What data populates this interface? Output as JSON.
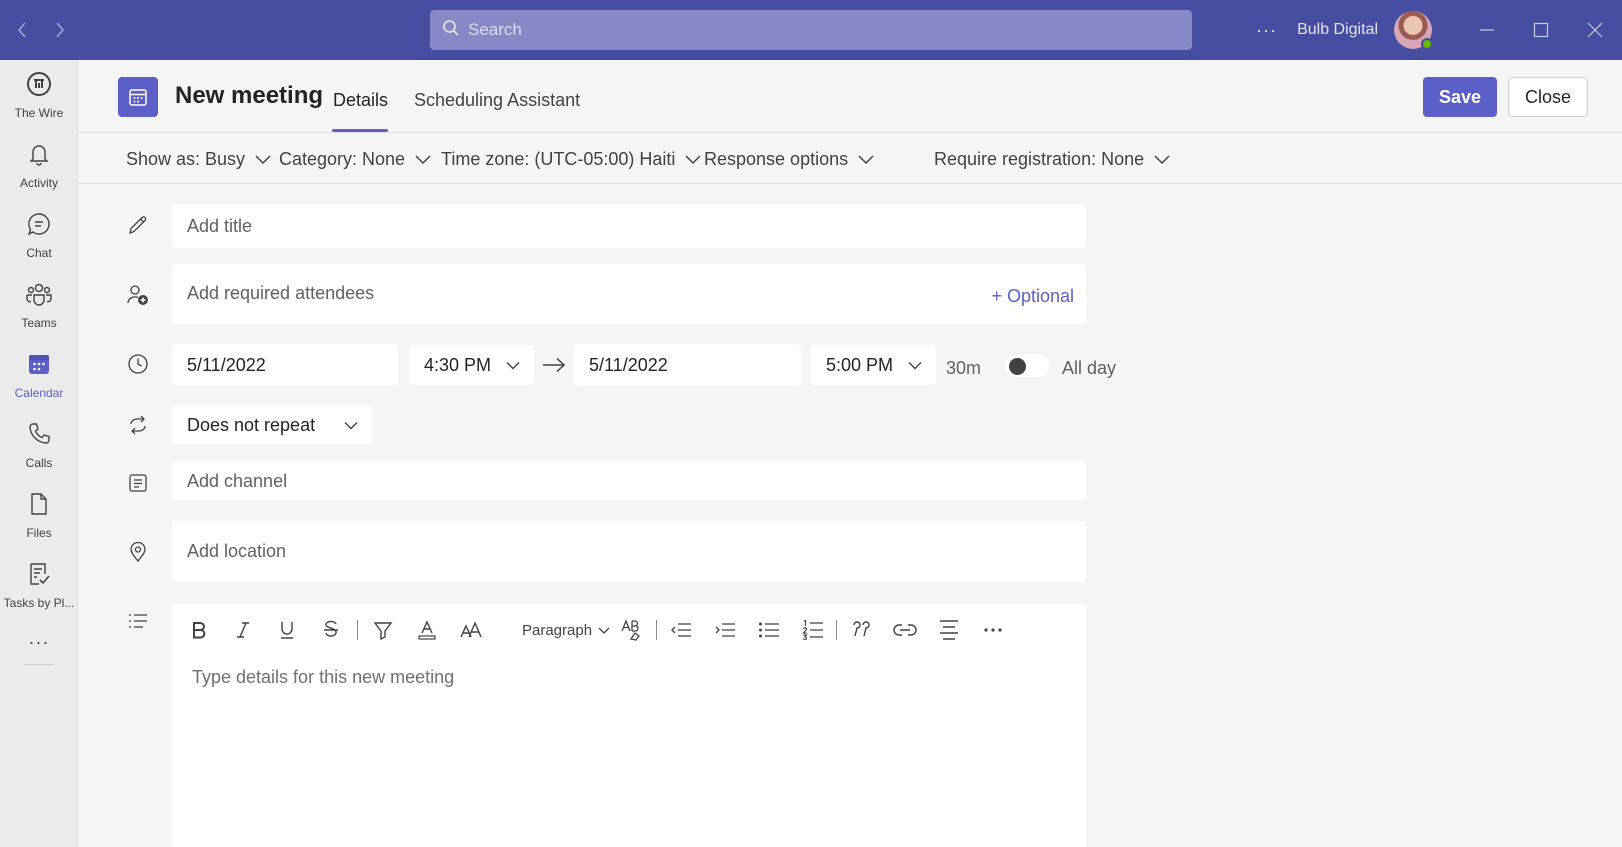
{
  "titlebar": {
    "search_placeholder": "Search",
    "more": "···",
    "org_name": "Bulb Digital"
  },
  "rail": {
    "items": [
      {
        "label": "The Wire"
      },
      {
        "label": "Activity"
      },
      {
        "label": "Chat"
      },
      {
        "label": "Teams"
      },
      {
        "label": "Calendar"
      },
      {
        "label": "Calls"
      },
      {
        "label": "Files"
      },
      {
        "label": "Tasks by Pl..."
      }
    ],
    "more": "···"
  },
  "header": {
    "title": "New meeting",
    "tab_details": "Details",
    "tab_scheduling": "Scheduling Assistant",
    "save": "Save",
    "close": "Close"
  },
  "options": {
    "show_as": "Show as: Busy",
    "category": "Category: None",
    "time_zone": "Time zone: (UTC-05:00) Haiti",
    "response": "Response options",
    "registration": "Require registration: None"
  },
  "form": {
    "title_placeholder": "Add title",
    "attendees_placeholder": "Add required attendees",
    "optional_link": "+ Optional",
    "start_date": "5/11/2022",
    "start_time": "4:30 PM",
    "end_date": "5/11/2022",
    "end_time": "5:00 PM",
    "duration": "30m",
    "all_day": "All day",
    "repeat": "Does not repeat",
    "channel_placeholder": "Add channel",
    "location_placeholder": "Add location"
  },
  "editor": {
    "paragraph": "Paragraph",
    "placeholder": "Type details for this new meeting"
  },
  "colors": {
    "titlebar": "#464ea2",
    "accent": "#5b5fc7",
    "search_bg": "#8689c6",
    "page_bg": "#f5f5f5"
  }
}
